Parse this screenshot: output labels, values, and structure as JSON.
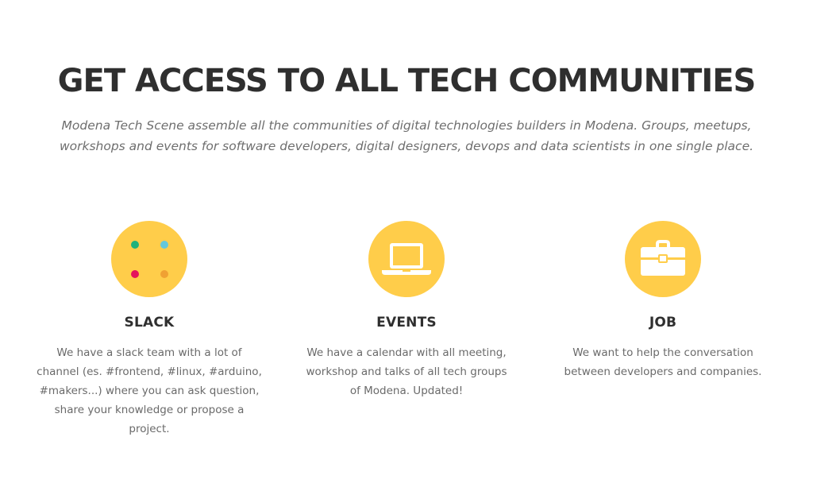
{
  "hero": {
    "title": "GET ACCESS TO ALL TECH COMMUNITIES",
    "subtitle": "Modena Tech Scene assemble all the communities of digital technologies builders in Modena. Groups, meetups, workshops and events for software developers, digital designers, devops and data scientists in one single place."
  },
  "colors": {
    "icon_background": "#ffcd4a",
    "slack_dot_green": "#1fb27c",
    "slack_dot_blue": "#66c7d9",
    "slack_dot_red": "#e5135c",
    "slack_dot_orange": "#f0a133",
    "title_text": "#2f2f2f",
    "body_text": "#6a6a6a"
  },
  "features": [
    {
      "icon": "slack-dots-icon",
      "title": "SLACK",
      "text": "We have a slack team with a lot of channel (es. #frontend, #linux, #arduino, #makers...) where you can ask question, share your knowledge or propose a project."
    },
    {
      "icon": "laptop-icon",
      "title": "EVENTS",
      "text": "We have a calendar with all meeting, workshop and talks of all tech groups of Modena. Updated!"
    },
    {
      "icon": "briefcase-icon",
      "title": "JOB",
      "text": "We want to help the conversation between developers and companies."
    }
  ]
}
